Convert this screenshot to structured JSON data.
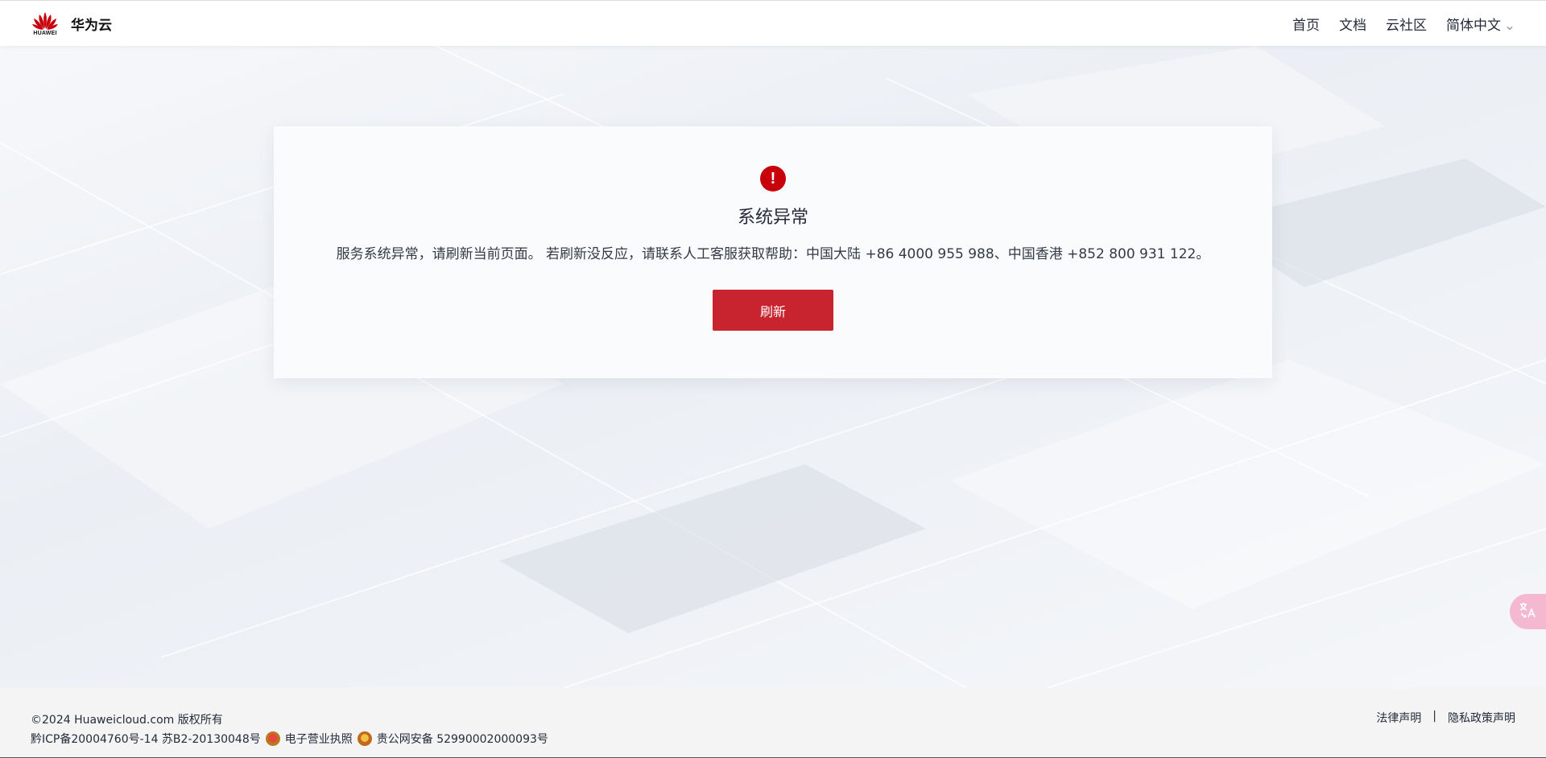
{
  "header": {
    "logo_text": "HUAWEI",
    "brand_name": "华为云",
    "nav": [
      "首页",
      "文档",
      "云社区"
    ],
    "language": "简体中文"
  },
  "card": {
    "title": "系统异常",
    "message": "服务系统异常，请刷新当前页面。 若刷新没反应，请联系人工客服获取帮助：中国大陆 +86 4000 955 988、中国香港 +852 800 931 122。",
    "button_label": "刷新",
    "icon_glyph": "!"
  },
  "footer": {
    "copyright": "©2024 Huaweicloud.com 版权所有",
    "icp": "黔ICP备20004760号-14 苏B2-20130048号",
    "license": "电子营业执照",
    "police": "贵公网安备 52990002000093号",
    "legal": "法律声明",
    "separator": "|",
    "privacy": "隐私政策声明"
  },
  "colors": {
    "accent": "#c7000b",
    "button": "#c7242f"
  },
  "icons": [
    "huawei-logo-icon",
    "chevron-down-icon",
    "error-icon",
    "translate-icon",
    "license-badge-icon",
    "police-badge-icon"
  ]
}
